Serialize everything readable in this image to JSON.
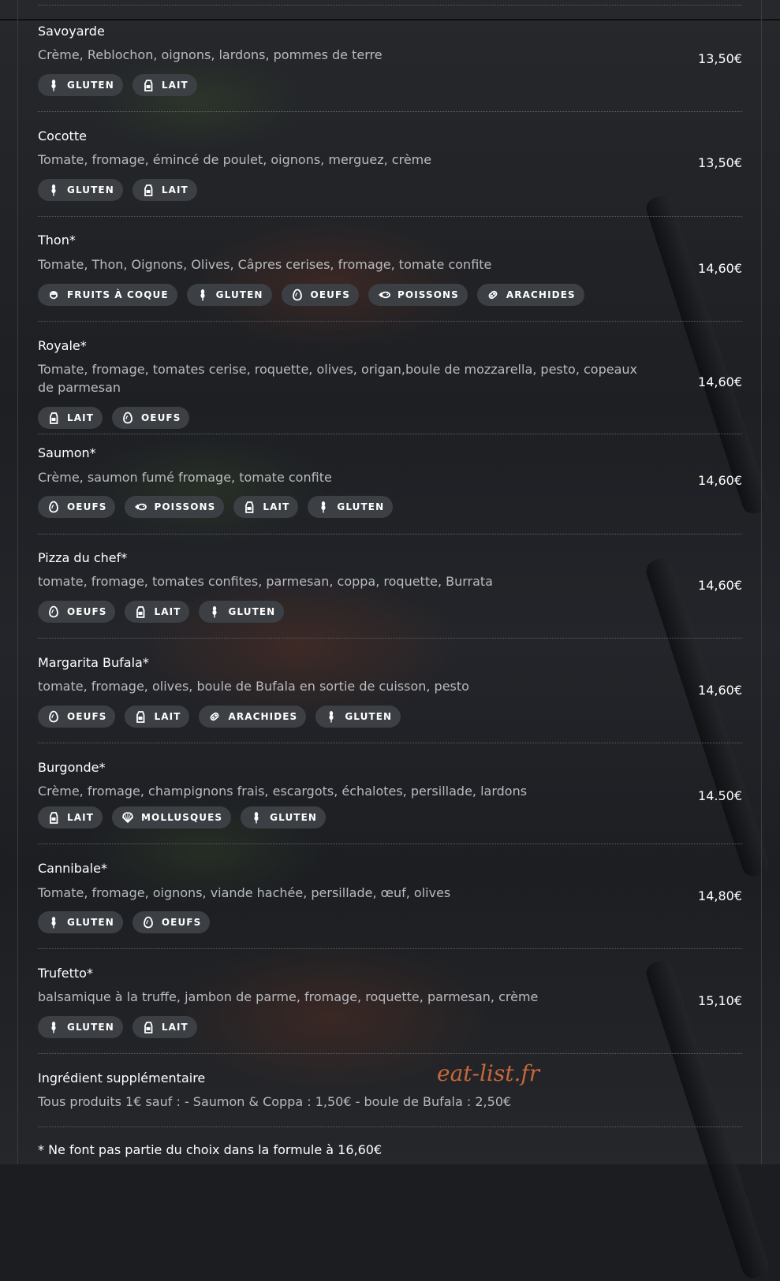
{
  "items": [
    {
      "name": "Savoyarde",
      "desc": "Crème, Reblochon, oignons, lardons, pommes de terre",
      "price": "13,50€",
      "allergens": [
        "GLUTEN",
        "LAIT"
      ]
    },
    {
      "name": "Cocotte",
      "desc": "Tomate, fromage, émincé de poulet, oignons, merguez, crème",
      "price": "13,50€",
      "allergens": [
        "GLUTEN",
        "LAIT"
      ]
    },
    {
      "name": "Thon*",
      "desc": "Tomate, Thon, Oignons, Olives, Câpres cerises, fromage, tomate confite",
      "price": "14,60€",
      "allergens": [
        "FRUITS À COQUE",
        "GLUTEN",
        "OEUFS",
        "POISSONS",
        "ARACHIDES"
      ]
    },
    {
      "name": "Royale*",
      "desc": "Tomate, fromage, tomates cerise, roquette, olives, origan,boule de mozzarella, pesto, copeaux de parmesan",
      "price": "14,60€",
      "allergens": [
        "LAIT",
        "OEUFS"
      ]
    },
    {
      "name": "Saumon*",
      "desc": "Crème, saumon fumé fromage, tomate confite",
      "price": "14,60€",
      "allergens": [
        "OEUFS",
        "POISSONS",
        "LAIT",
        "GLUTEN"
      ]
    },
    {
      "name": "Pizza du chef*",
      "desc": "tomate, fromage, tomates confites, parmesan, coppa, roquette, Burrata",
      "price": "14,60€",
      "allergens": [
        "OEUFS",
        "LAIT",
        "GLUTEN"
      ]
    },
    {
      "name": "Margarita Bufala*",
      "desc": "tomate, fromage, olives, boule de Bufala en sortie de cuisson, pesto",
      "price": "14,60€",
      "allergens": [
        "OEUFS",
        "LAIT",
        "ARACHIDES",
        "GLUTEN"
      ]
    },
    {
      "name": "Burgonde*",
      "desc": "Crème, fromage, champignons frais, escargots, échalotes, persillade, lardons",
      "price": "14.50€",
      "allergens": [
        "LAIT",
        "MOLLUSQUES",
        "GLUTEN"
      ]
    },
    {
      "name": "Cannibale*",
      "desc": "Tomate, fromage, oignons, viande hachée, persillade, œuf, olives",
      "price": "14,80€",
      "allergens": [
        "GLUTEN",
        "OEUFS"
      ]
    },
    {
      "name": "Trufetto*",
      "desc": "balsamique à la truffe, jambon de parme, fromage, roquette, parmesan, crème",
      "price": "15,10€",
      "allergens": [
        "GLUTEN",
        "LAIT"
      ]
    }
  ],
  "extra": {
    "title": "Ingrédient supplémentaire",
    "desc": "Tous produits 1€ sauf : - Saumon & Coppa : 1,50€ - boule de Bufala : 2,50€"
  },
  "footnote": "* Ne font pas partie du choix dans la formule à 16,60€",
  "watermark": "eat-list.fr",
  "icons": {
    "GLUTEN": "wheat-icon",
    "LAIT": "milk-carton-icon",
    "OEUFS": "egg-icon",
    "POISSONS": "fish-icon",
    "ARACHIDES": "peanut-icon",
    "FRUITS À COQUE": "acorn-icon",
    "MOLLUSQUES": "shell-icon"
  },
  "colors": {
    "background": "#1b1d21",
    "tag": "#3c3f44",
    "desc": "#b9bbbf",
    "watermark": "#c8673a"
  }
}
